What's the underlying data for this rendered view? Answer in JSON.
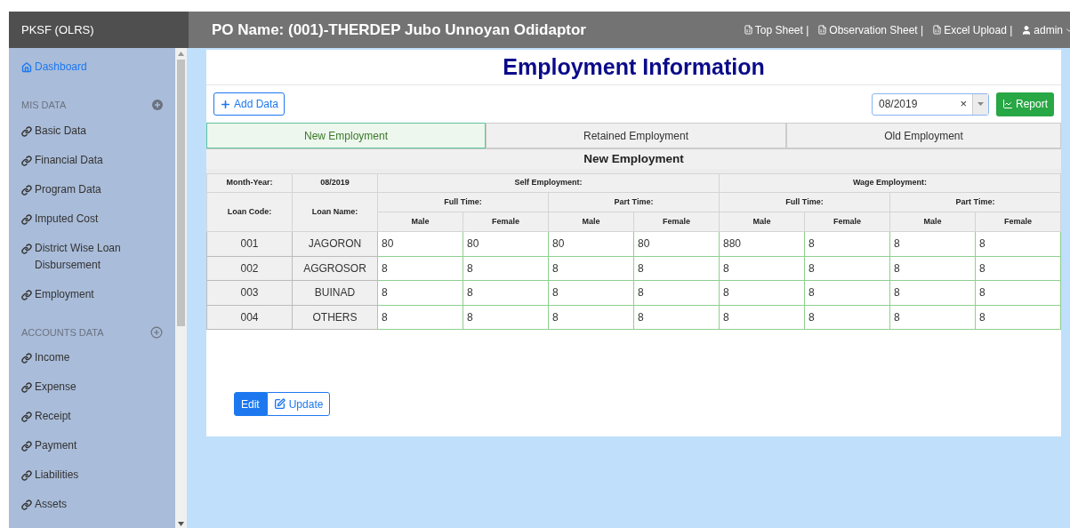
{
  "brand": "PKSF (OLRS)",
  "header": {
    "title": "PO Name: (001)-THERDEP Jubo Unnoyan Odidaptor",
    "links": [
      {
        "kind": "file",
        "label": "Top Sheet |"
      },
      {
        "kind": "file",
        "label": "Observation Sheet |"
      },
      {
        "kind": "file",
        "label": "Excel Upload |"
      },
      {
        "kind": "user",
        "label": "admin"
      }
    ]
  },
  "sidebar": {
    "items": [
      {
        "kind": "home",
        "label": "Dashboard",
        "selected": true
      },
      {
        "kind": "section",
        "label": "MIS DATA",
        "filled": true
      },
      {
        "kind": "link",
        "label": "Basic Data",
        "selected": false
      },
      {
        "kind": "link",
        "label": "Financial Data",
        "selected": false
      },
      {
        "kind": "link",
        "label": "Program Data",
        "selected": false
      },
      {
        "kind": "link",
        "label": "Imputed Cost",
        "selected": false
      },
      {
        "kind": "link",
        "label": "District Wise Loan Disbursement",
        "selected": false
      },
      {
        "kind": "link",
        "label": "Employment",
        "selected": false
      },
      {
        "kind": "section",
        "label": "ACCOUNTS DATA",
        "filled": false
      },
      {
        "kind": "link",
        "label": "Income",
        "selected": false
      },
      {
        "kind": "link",
        "label": "Expense",
        "selected": false
      },
      {
        "kind": "link",
        "label": "Receipt",
        "selected": false
      },
      {
        "kind": "link",
        "label": "Payment",
        "selected": false
      },
      {
        "kind": "link",
        "label": "Liabilities",
        "selected": false
      },
      {
        "kind": "link",
        "label": "Assets",
        "selected": false
      }
    ]
  },
  "page_title": "Employment Information",
  "add_button": "Add Data",
  "month_select": {
    "value": "08/2019",
    "clear": "×"
  },
  "report_button": "Report",
  "tabs": [
    {
      "label": "New Employment",
      "selected": true
    },
    {
      "label": "Retained Employment",
      "selected": false
    },
    {
      "label": "Old Employment",
      "selected": false
    }
  ],
  "table": {
    "title": "New Employment",
    "month_label": "Month-Year:",
    "month_value": "08/2019",
    "groups": [
      "Self Employment:",
      "Wage Employment:"
    ],
    "subgroups": [
      "Full Time:",
      "Part Time:",
      "Full Time:",
      "Part Time:"
    ],
    "code_header": "Loan Code:",
    "name_header": "Loan Name:",
    "gender_headers": [
      "Male",
      "Female",
      "Male",
      "Female",
      "Male",
      "Female",
      "Male",
      "Female"
    ],
    "rows": [
      {
        "code": "001",
        "name": "JAGORON",
        "values": [
          "80",
          "80",
          "80",
          "80",
          "880",
          "8",
          "8",
          "8"
        ]
      },
      {
        "code": "002",
        "name": "AGGROSOR",
        "values": [
          "8",
          "8",
          "8",
          "8",
          "8",
          "8",
          "8",
          "8"
        ]
      },
      {
        "code": "003",
        "name": "BUINAD",
        "values": [
          "8",
          "8",
          "8",
          "8",
          "8",
          "8",
          "8",
          "8"
        ]
      },
      {
        "code": "004",
        "name": "OTHERS",
        "values": [
          "8",
          "8",
          "8",
          "8",
          "8",
          "8",
          "8",
          "8"
        ]
      }
    ]
  },
  "actions": [
    {
      "kind": "plain",
      "label": "Edit",
      "selected": true
    },
    {
      "kind": "edit",
      "label": "Update",
      "selected": false
    }
  ]
}
